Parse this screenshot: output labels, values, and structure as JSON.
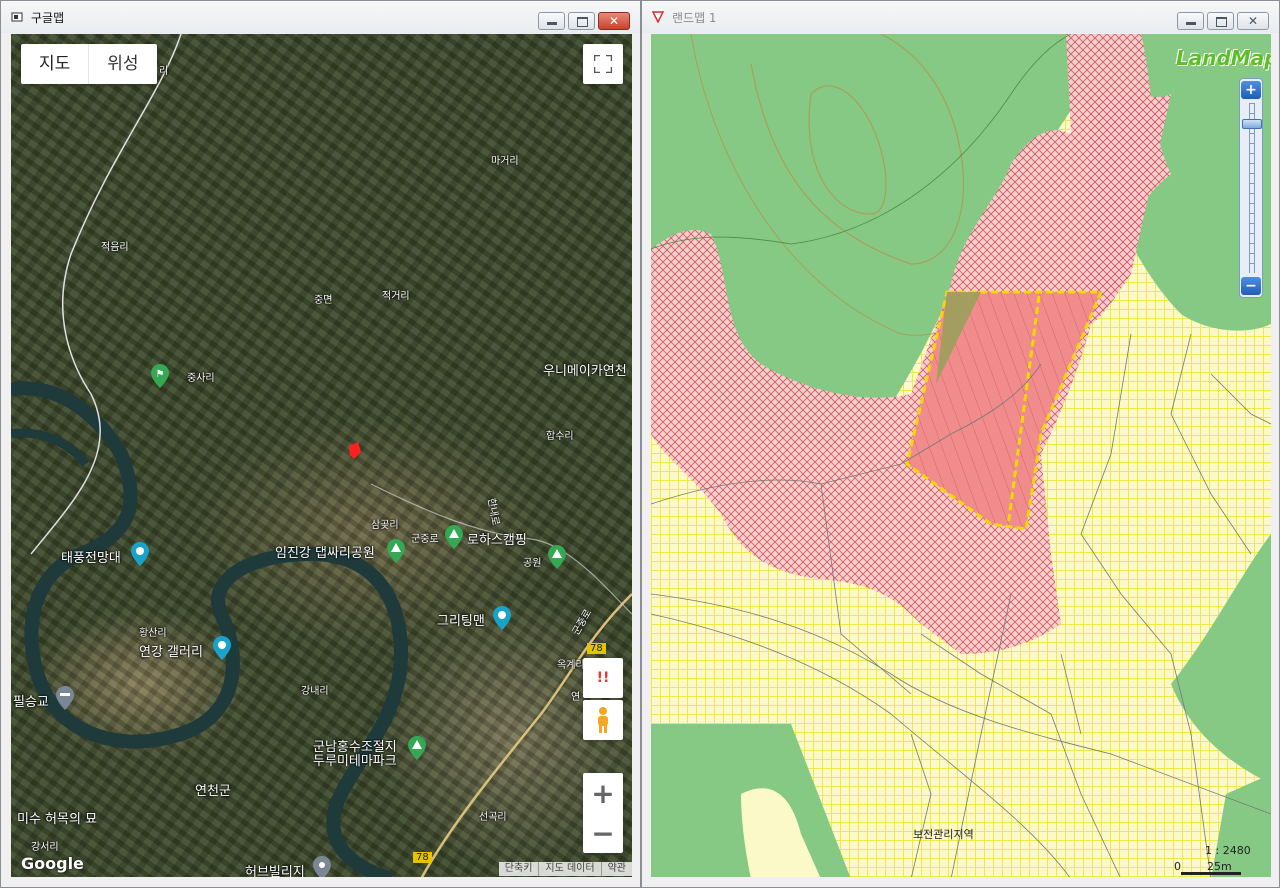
{
  "left_window": {
    "title": "구글맵",
    "map_type": {
      "map": "지도",
      "satellite": "위성"
    },
    "labels": [
      {
        "name": "label-jeogeumri",
        "text": "적음리"
      },
      {
        "name": "label-ri-top",
        "text": "리"
      },
      {
        "name": "label-magari",
        "text": "마거리"
      },
      {
        "name": "label-jungmyeon",
        "text": "중면"
      },
      {
        "name": "label-jeokgeori",
        "text": "적거리"
      },
      {
        "name": "label-jungsari",
        "text": "중사리"
      },
      {
        "name": "label-wonimeika",
        "text": "우니메이카연천"
      },
      {
        "name": "label-hapsuri",
        "text": "합수리"
      },
      {
        "name": "label-hannaero",
        "text": "한내로"
      },
      {
        "name": "label-samgotri",
        "text": "삼곶리"
      },
      {
        "name": "label-gunjungro",
        "text": "군중로"
      },
      {
        "name": "label-rohaseu",
        "text": "로하스캠핑"
      },
      {
        "name": "label-park",
        "text": "공원"
      },
      {
        "name": "label-taepung",
        "text": "태풍전망대"
      },
      {
        "name": "label-imjingang",
        "text": "임진강 댑싸리공원"
      },
      {
        "name": "label-greeting",
        "text": "그리팅맨"
      },
      {
        "name": "label-hwangsanri",
        "text": "황산리"
      },
      {
        "name": "label-yeongang-gallery",
        "text": "연강 갤러리"
      },
      {
        "name": "label-gunjung-ro2",
        "text": "군중로"
      },
      {
        "name": "label-route78-top",
        "text": "78"
      },
      {
        "name": "label-okgyeri",
        "text": "옥계리"
      },
      {
        "name": "label-yeon",
        "text": "연"
      },
      {
        "name": "label-pilseunggyo",
        "text": "필승교"
      },
      {
        "name": "label-gangnaeri",
        "text": "강내리"
      },
      {
        "name": "label-gunnam",
        "text": "군남홍수조절지"
      },
      {
        "name": "label-durumi",
        "text": "두루미테마파크"
      },
      {
        "name": "label-yeoncheongun",
        "text": "연천군"
      },
      {
        "name": "label-misu",
        "text": "미수 허목의 묘"
      },
      {
        "name": "label-seongokri",
        "text": "선곡리"
      },
      {
        "name": "label-gangseori",
        "text": "강서리"
      },
      {
        "name": "label-route78-bottom",
        "text": "78"
      },
      {
        "name": "label-heobeu",
        "text": "허브빌리지"
      }
    ],
    "alert_glyph": "!!",
    "zoom_in": "+",
    "zoom_out": "−",
    "google_logo": "Google",
    "attribution": [
      "단축키",
      "지도 데이터",
      "약관"
    ]
  },
  "right_window": {
    "title": "랜드맵 1",
    "logo": "LandMap",
    "zoom_in": "+",
    "zoom_out": "−",
    "area_label": "보전관리지역",
    "scale_ratio": "1 : 2480",
    "scale_zero": "0",
    "scale_length": "25m"
  },
  "colors": {
    "forest_green": "#86c984",
    "pink_hatch": "#f2b6b8",
    "selected_parcel": "#f08888",
    "parcel_outline": "#f5d800",
    "yellow_grid": "#f0e84a"
  }
}
